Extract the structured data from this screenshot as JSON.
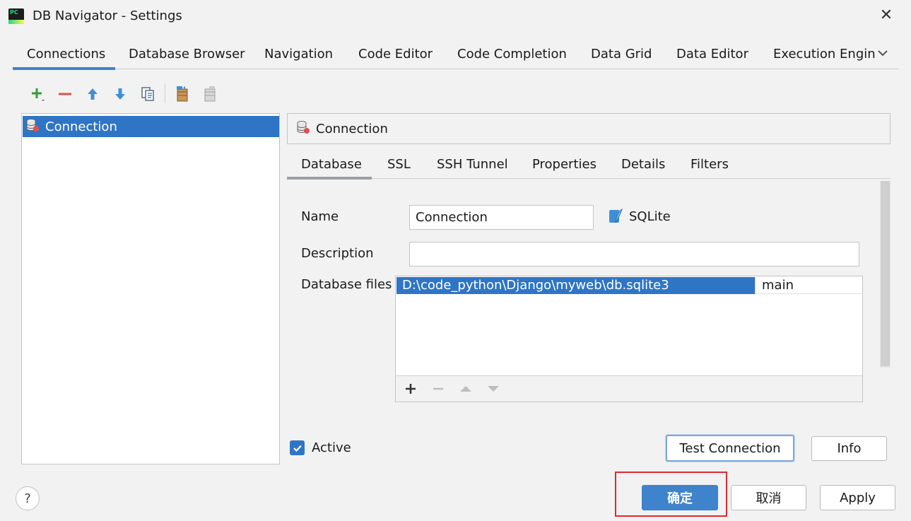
{
  "window": {
    "title": "DB Navigator - Settings",
    "close_icon": "close-icon"
  },
  "top_tabs": [
    {
      "label": "Connections",
      "active": true
    },
    {
      "label": "Database Browser"
    },
    {
      "label": "Navigation"
    },
    {
      "label": "Code Editor"
    },
    {
      "label": "Code Completion"
    },
    {
      "label": "Data Grid"
    },
    {
      "label": "Data Editor"
    },
    {
      "label": "Execution Engin"
    }
  ],
  "toolbar": {
    "icons": [
      "add-icon",
      "remove-icon",
      "move-up-icon",
      "move-down-icon",
      "copy-icon",
      "export-icon",
      "import-icon"
    ]
  },
  "connections": [
    {
      "label": "Connection",
      "selected": true
    }
  ],
  "connection_panel": {
    "title": "Connection",
    "sub_tabs": [
      {
        "label": "Database",
        "active": true
      },
      {
        "label": "SSL"
      },
      {
        "label": "SSH Tunnel"
      },
      {
        "label": "Properties"
      },
      {
        "label": "Details"
      },
      {
        "label": "Filters"
      }
    ],
    "form": {
      "name_label": "Name",
      "name_value": "Connection",
      "db_type": "SQLite",
      "description_label": "Description",
      "description_value": "",
      "database_files_label": "Database files",
      "database_files": [
        {
          "path": "D:\\code_python\\Django\\myweb\\db.sqlite3",
          "schema": "main"
        }
      ],
      "files_toolbar_icons": [
        "add-icon",
        "remove-icon",
        "move-up-icon",
        "move-down-icon"
      ]
    },
    "active_label": "Active",
    "active_checked": true,
    "test_connection_label": "Test Connection",
    "info_label": "Info"
  },
  "footer": {
    "help_label": "?",
    "ok_label": "确定",
    "cancel_label": "取消",
    "apply_label": "Apply"
  },
  "colors": {
    "accent": "#2f75c5",
    "primary_button": "#3f83cc",
    "highlight": "#e0282e"
  }
}
